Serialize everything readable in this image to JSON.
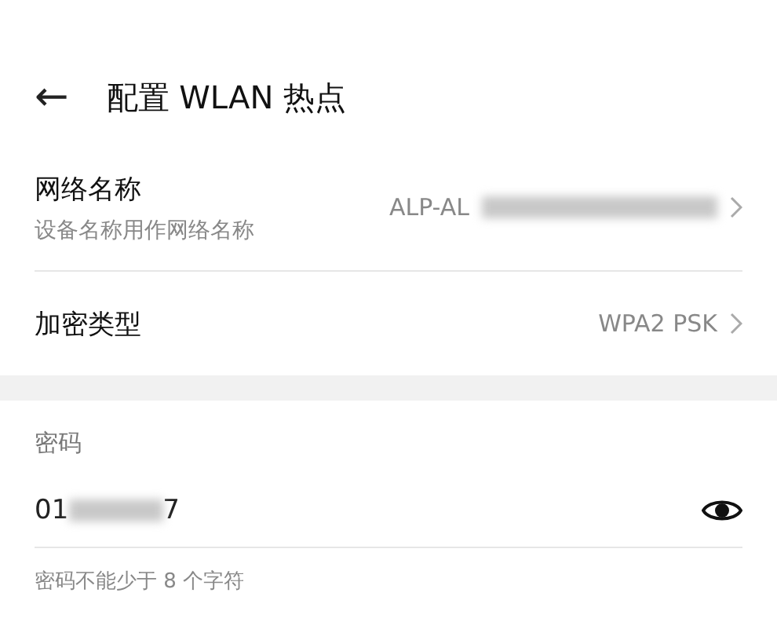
{
  "header": {
    "back": "←",
    "title": "配置 WLAN 热点"
  },
  "settings": [
    {
      "label": "网络名称",
      "sublabel": "设备名称用作网络名称",
      "value": "ALP-AL",
      "value_blurred": true
    },
    {
      "label": "加密类型",
      "value": "WPA2 PSK",
      "value_blurred": false
    }
  ],
  "password": {
    "label": "密码",
    "value_start": "01",
    "value_end": "7",
    "hint": "密码不能少于 8 个字符"
  }
}
